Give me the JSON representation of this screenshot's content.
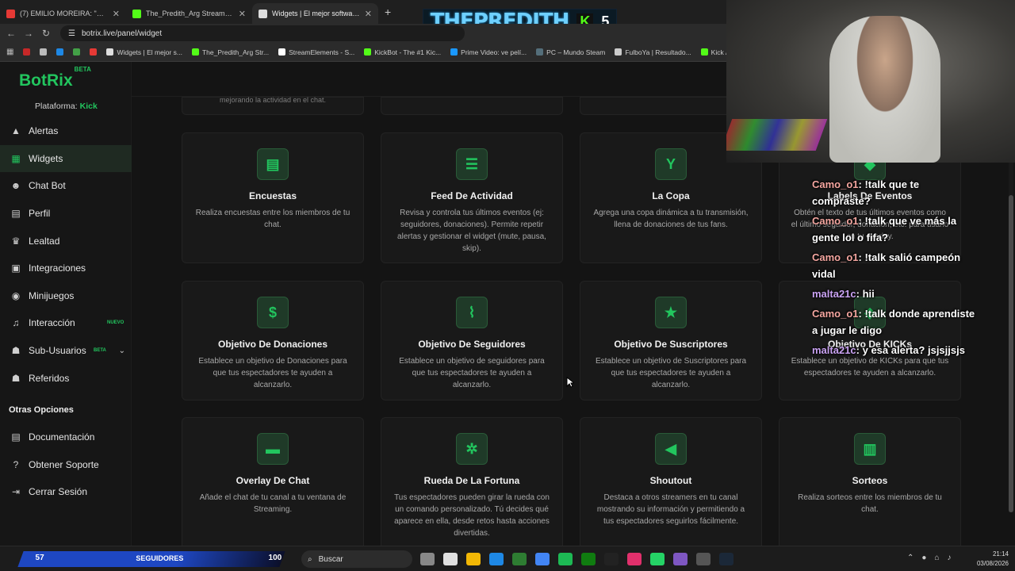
{
  "browser": {
    "tabs": [
      {
        "title": "(7) EMILIO MOREIRA: \"Es muy d",
        "color": "#e53935"
      },
      {
        "title": "The_Predith_Arg Stream - Watc",
        "color": "#53fc18"
      },
      {
        "title": "Widgets | El mejor software par",
        "color": "#dddddd"
      }
    ],
    "new_tab": "+",
    "url": "botrix.live/panel/widget",
    "bookmarks": [
      {
        "label": "",
        "color": "#c62828"
      },
      {
        "label": "",
        "color": "#bbbbbb"
      },
      {
        "label": "",
        "color": "#1e88e5"
      },
      {
        "label": "",
        "color": "#43a047"
      },
      {
        "label": "",
        "color": "#e53935"
      },
      {
        "label": "Widgets | El mejor s...",
        "color": "#dddddd"
      },
      {
        "label": "The_Predith_Arg Str...",
        "color": "#53fc18"
      },
      {
        "label": "StreamElements - S...",
        "color": "#ffffff"
      },
      {
        "label": "KickBot - The #1 Kic...",
        "color": "#53fc18"
      },
      {
        "label": "Prime Video: ve pelí...",
        "color": "#1a98ff"
      },
      {
        "label": "PC – Mundo Steam",
        "color": "#546e7a"
      },
      {
        "label": "FulboYa | Resultado...",
        "color": "#cccccc"
      },
      {
        "label": "Kick / Descar",
        "color": "#53fc18"
      }
    ]
  },
  "stream_banner": {
    "name": "THEPREDITH",
    "k": "K",
    "count": "5"
  },
  "app": {
    "logo": "BotRix",
    "logo_badge": "BETA",
    "platform_label": "Plataforma:",
    "platform_value": "Kick",
    "menu": [
      {
        "label": "Alertas",
        "icon": "alert-icon",
        "glyph": "▲"
      },
      {
        "label": "Widgets",
        "icon": "widgets-icon",
        "glyph": "▦",
        "active": true
      },
      {
        "label": "Chat Bot",
        "icon": "robot-icon",
        "glyph": "☻"
      },
      {
        "label": "Perfil",
        "icon": "profile-icon",
        "glyph": "▤"
      },
      {
        "label": "Lealtad",
        "icon": "trophy-icon",
        "glyph": "♛"
      },
      {
        "label": "Integraciones",
        "icon": "integrations-icon",
        "glyph": "▣"
      },
      {
        "label": "Minijuegos",
        "icon": "gamepad-icon",
        "glyph": "◉"
      },
      {
        "label": "Interacción",
        "icon": "music-icon",
        "glyph": "♫",
        "badge": "NUEVO"
      },
      {
        "label": "Sub-Usuarios",
        "icon": "users-icon",
        "glyph": "☗",
        "badge": "BETA",
        "chevron": "⌄"
      },
      {
        "label": "Referidos",
        "icon": "referrals-icon",
        "glyph": "☗"
      }
    ],
    "other_section": "Otras Opciones",
    "menu2": [
      {
        "label": "Documentación",
        "icon": "docs-icon",
        "glyph": "▤"
      },
      {
        "label": "Obtener Soporte",
        "icon": "help-icon",
        "glyph": "?"
      },
      {
        "label": "Cerrar Sesión",
        "icon": "logout-icon",
        "glyph": "⇥"
      }
    ],
    "partial_top": [
      {
        "desc": "mejorando la actividad en el chat."
      },
      {
        "desc": ""
      },
      {
        "desc": ""
      }
    ],
    "widgets": [
      {
        "title": "Encuestas",
        "desc": "Realiza encuestas entre los miembros de tu chat.",
        "icon": "poll-icon",
        "glyph": "▤"
      },
      {
        "title": "Feed De Actividad",
        "desc": "Revisa y controla tus últimos eventos (ej: seguidores, donaciones). Permite repetir alertas y gestionar el widget (mute, pausa, skip).",
        "icon": "list-icon",
        "glyph": "☰"
      },
      {
        "title": "La Copa",
        "desc": "Agrega una copa dinámica a tu transmisión, llena de donaciones de tus fans.",
        "icon": "cup-icon",
        "glyph": "Y"
      },
      {
        "title": "Labels De Eventos",
        "desc": "Obtén el texto de tus últimos eventos como el último seguidor, donación, etc. para usarlo en tu overlay.",
        "icon": "tag-icon",
        "glyph": "◆"
      },
      {
        "title": "Objetivo De Donaciones",
        "desc": "Establece un objetivo de Donaciones para que tus espectadores te ayuden a alcanzarlo.",
        "icon": "dollar-icon",
        "glyph": "$"
      },
      {
        "title": "Objetivo De Seguidores",
        "desc": "Establece un objetivo de seguidores para que tus espectadores te ayuden a alcanzarlo.",
        "icon": "chart-icon",
        "glyph": "⌇"
      },
      {
        "title": "Objetivo De Suscriptores",
        "desc": "Establece un objetivo de Suscriptores para que tus espectadores te ayuden a alcanzarlo.",
        "icon": "star-icon",
        "glyph": "★"
      },
      {
        "title": "Objetivo De KICKs",
        "desc": "Establece un objetivo de KICKs para que tus espectadores te ayuden a alcanzarlo.",
        "icon": "gem-icon",
        "glyph": "◆"
      },
      {
        "title": "Overlay De Chat",
        "desc": "Añade el chat de tu canal a tu ventana de Streaming.",
        "icon": "chat-icon",
        "glyph": "▬"
      },
      {
        "title": "Rueda De La Fortuna",
        "desc": "Tus espectadores pueden girar la rueda con un comando personalizado. Tú decides qué aparece en ella, desde retos hasta acciones divertidas.",
        "icon": "wheel-icon",
        "glyph": "✲"
      },
      {
        "title": "Shoutout",
        "desc": "Destaca a otros streamers en tu canal mostrando su información y permitiendo a tus espectadores seguirlos fácilmente.",
        "icon": "megaphone-icon",
        "glyph": "◀"
      },
      {
        "title": "Sorteos",
        "desc": "Realiza sorteos entre los miembros de tu chat.",
        "icon": "gift-icon",
        "glyph": "▥"
      }
    ]
  },
  "chat_overlay": [
    {
      "user": "Camo_o1",
      "msg": ": !talk que te compraste?",
      "color": "#f4a6a0"
    },
    {
      "user": "Camo_o1",
      "msg": ": !talk que ve más la gente lol o fifa?",
      "color": "#f4a6a0"
    },
    {
      "user": "Camo_o1",
      "msg": ": !talk salió campeón vidal",
      "color": "#f4a6a0"
    },
    {
      "user": "malta21c",
      "msg": ": hii",
      "color": "#c9a2f2"
    },
    {
      "user": "Camo_o1",
      "msg": ": !talk donde aprendiste a jugar le digo",
      "color": "#f4a6a0"
    },
    {
      "user": "malta21c",
      "msg": ": y esa alerta? jsjsjjsjs",
      "color": "#c9a2f2"
    }
  ],
  "taskbar": {
    "sub_count": "57",
    "sub_label": "SEGUIDORES",
    "sub_goal": "100",
    "search_placeholder": "Buscar",
    "time": "21:14",
    "date": "03/08/2026",
    "app_colors": [
      "#888888",
      "#e0e0e0",
      "#f2b705",
      "#1e88e5",
      "#2e7d32",
      "#4285f4",
      "#1db954",
      "#107c10",
      "#222222",
      "#e1306c",
      "#25d366",
      "#7e57c2",
      "#555555",
      "#1b2838"
    ]
  },
  "colors": {
    "accent": "#22c55e"
  }
}
